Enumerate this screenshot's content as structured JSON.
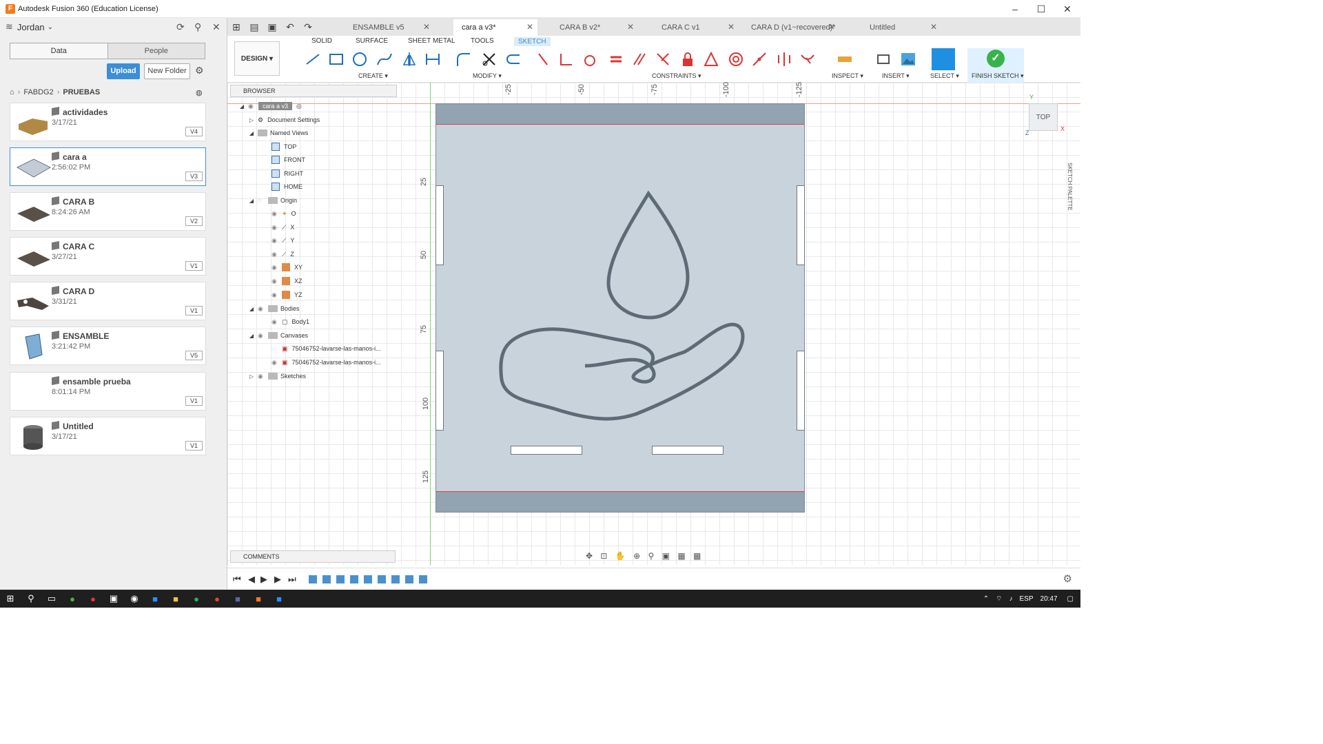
{
  "window": {
    "title": "Autodesk Fusion 360 (Education License)",
    "minimize": "–",
    "maximize": "☐",
    "close": "✕"
  },
  "datapanel": {
    "user": "Jordan",
    "tabs": [
      "Data",
      "People"
    ],
    "upload_label": "Upload",
    "new_folder_label": "New Folder",
    "breadcrumb": [
      "FABDG2",
      "PRUEBAS"
    ],
    "files": [
      {
        "name": "actividades",
        "date": "3/17/21",
        "version": "V4"
      },
      {
        "name": "cara a",
        "date": "2:56:02 PM",
        "version": "V3"
      },
      {
        "name": "CARA B",
        "date": "8:24:26 AM",
        "version": "V2"
      },
      {
        "name": "CARA C",
        "date": "3/27/21",
        "version": "V1"
      },
      {
        "name": "CARA D",
        "date": "3/31/21",
        "version": "V1"
      },
      {
        "name": "ENSAMBLE",
        "date": "3:21:42 PM",
        "version": "V5"
      },
      {
        "name": "ensamble prueba",
        "date": "8:01:14 PM",
        "version": "V1"
      },
      {
        "name": "Untitled",
        "date": "3/17/21",
        "version": "V1"
      }
    ]
  },
  "doctabs": [
    "ENSAMBLE v5",
    "cara a v3*",
    "CARA B v2*",
    "CARA C v1",
    "CARA D (v1~recovered)*",
    "Untitled"
  ],
  "ribbon": {
    "workspace": "DESIGN ▾",
    "tabs": [
      "SOLID",
      "SURFACE",
      "SHEET METAL",
      "TOOLS",
      "SKETCH"
    ],
    "groups": [
      "CREATE ▾",
      "MODIFY ▾",
      "CONSTRAINTS ▾",
      "INSPECT ▾",
      "INSERT ▾",
      "SELECT ▾",
      "FINISH SKETCH ▾"
    ]
  },
  "browser": {
    "title": "BROWSER",
    "root": "cara a v3",
    "items": [
      "Document Settings",
      "Named Views",
      "TOP",
      "FRONT",
      "RIGHT",
      "HOME",
      "Origin",
      "O",
      "X",
      "Y",
      "Z",
      "XY",
      "XZ",
      "YZ",
      "Bodies",
      "Body1",
      "Canvases",
      "75046752-lavarse-las-manos-i...",
      "75046752-lavarse-las-manos-i...",
      "Sketches"
    ]
  },
  "canvas": {
    "ruler_top": [
      "-25",
      "-50",
      "-75",
      "-100",
      "-125"
    ],
    "ruler_left": [
      "25",
      "50",
      "75",
      "100",
      "125"
    ],
    "viewcube_label": "TOP",
    "palette_label": "SKETCH PALETTE",
    "axis_y": "Y",
    "axis_x": "X",
    "axis_z": "Z"
  },
  "comments_label": "COMMENTS",
  "tray": {
    "lang": "ESP",
    "time": "20:47"
  },
  "colors": {
    "accent": "#3b8ed8",
    "finish": "#38b34a",
    "sheet": "#c8d3dc"
  }
}
